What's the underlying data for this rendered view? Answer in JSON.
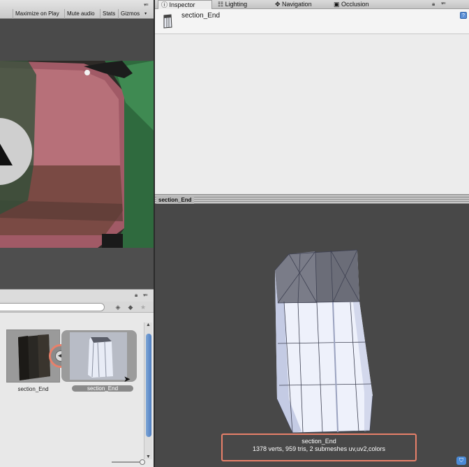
{
  "game_toolbar": {
    "buttons": [
      "Maximize on Play",
      "Mute audio",
      "Stats",
      "Gizmos"
    ]
  },
  "inspector": {
    "tabs": [
      "Inspector",
      "Lighting",
      "Navigation",
      "Occlusion"
    ],
    "active_tab": "Inspector",
    "object_name": "section_End"
  },
  "preview": {
    "title": "section_End",
    "mesh_name": "section_End",
    "mesh_stats": "1378 verts, 959 tris, 2 submeshes    uv,uv2,colors"
  },
  "project": {
    "assets": [
      {
        "label": "section_End",
        "selected": false
      },
      {
        "label": "section_End",
        "selected": true
      }
    ]
  },
  "colors": {
    "highlight": "#e8806a",
    "scroll_thumb": "#4f7fc3",
    "preview_bg": "#484848"
  }
}
